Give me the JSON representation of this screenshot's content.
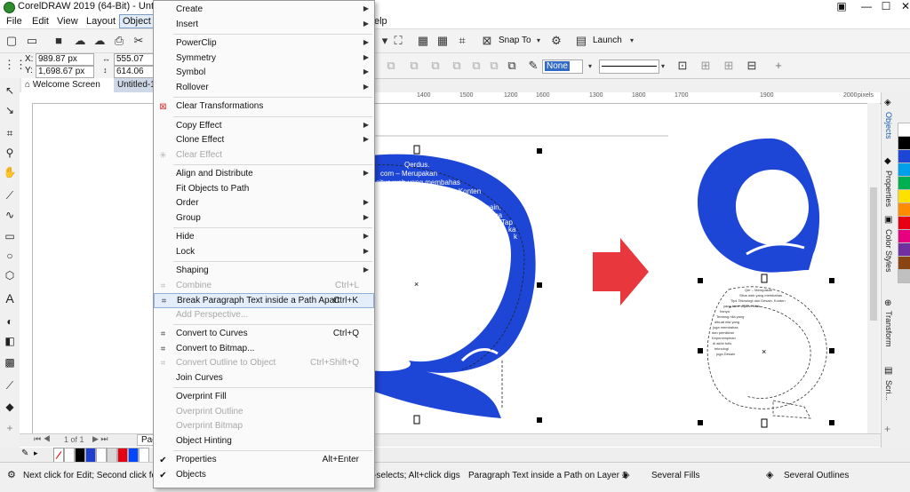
{
  "window": {
    "title": "CorelDRAW 2019 (64-Bit) - Untitled-1*"
  },
  "menubar": {
    "items": [
      "File",
      "Edit",
      "View",
      "Layout",
      "Object"
    ],
    "help": "elp"
  },
  "toolbar": {
    "snap_label": "Snap To",
    "launch_label": "Launch"
  },
  "property_bar": {
    "x_label": "X:",
    "x_value": "989.87 px",
    "y_label": "Y:",
    "y_value": "1,698.67 px",
    "w_value": "555.07 px",
    "h_value": "614.06 px",
    "outline_value": "None"
  },
  "tabs": {
    "welcome": "Welcome Screen",
    "doc": "Untitled-1"
  },
  "ruler": {
    "ticks": [
      "1200",
      "1300",
      "1400",
      "1500",
      "1600",
      "1700",
      "1800",
      "1900",
      "2000"
    ],
    "unit": "pixels"
  },
  "page_nav": {
    "label": "1 of 1",
    "page_tab": "Pag"
  },
  "artwork": {
    "path_text_lines": [
      "Qerdus.",
      "com – Merupakan",
      "ah situs web yang membahas",
      "Tips Teknologi dan Desain. Konten",
      "sajikan tidak",
      "hanya",
      "desain,",
      "juga",
      "Tap",
      "ka",
      "k"
    ],
    "small_text_lines": [
      "Qer – Merupakan",
      "Situs web yang membahas",
      "Tips Teknologi dan Desain. Konten",
      "yang kami sajikan tidak",
      "hanya",
      "Tentang nila yang",
      "dibuat nila yang",
      "juga membahas",
      "dan pemikiran",
      "Kepemimpinan",
      "di akhir tulis",
      "teknologi",
      "juga Desain"
    ],
    "blue": "#1d45d6",
    "arrow": "#e8383d"
  },
  "docker_tabs": [
    "Objects",
    "Properties",
    "Color Styles",
    "Transform",
    "Scri..."
  ],
  "context_menu": {
    "items": [
      {
        "label": "Create",
        "arrow": true
      },
      {
        "label": "Insert",
        "arrow": true
      },
      {
        "sep": true
      },
      {
        "label": "PowerClip",
        "arrow": true
      },
      {
        "label": "Symmetry",
        "arrow": true
      },
      {
        "label": "Symbol",
        "arrow": true
      },
      {
        "label": "Rollover",
        "arrow": true
      },
      {
        "sep": true
      },
      {
        "label": "Clear Transformations",
        "icon": "clear-transform-icon"
      },
      {
        "sep": true
      },
      {
        "label": "Copy Effect",
        "arrow": true
      },
      {
        "label": "Clone Effect",
        "arrow": true
      },
      {
        "label": "Clear Effect",
        "disabled": true,
        "icon": "clear-effect-icon"
      },
      {
        "sep": true
      },
      {
        "label": "Align and Distribute",
        "arrow": true
      },
      {
        "label": "Fit Objects to Path"
      },
      {
        "label": "Order",
        "arrow": true
      },
      {
        "label": "Group",
        "arrow": true
      },
      {
        "sep": true
      },
      {
        "label": "Hide",
        "arrow": true
      },
      {
        "label": "Lock",
        "arrow": true
      },
      {
        "sep": true
      },
      {
        "label": "Shaping",
        "arrow": true
      },
      {
        "label": "Combine",
        "shortcut": "Ctrl+L",
        "disabled": true,
        "icon": "combine-icon"
      },
      {
        "label": "Break Paragraph Text inside a Path Apart",
        "shortcut": "Ctrl+K",
        "highlight": true,
        "icon": "break-apart-icon"
      },
      {
        "label": "Add Perspective...",
        "disabled": true
      },
      {
        "sep": true
      },
      {
        "label": "Convert to Curves",
        "shortcut": "Ctrl+Q",
        "icon": "convert-curves-icon"
      },
      {
        "label": "Convert to Bitmap...",
        "icon": "convert-bitmap-icon"
      },
      {
        "label": "Convert Outline to Object",
        "shortcut": "Ctrl+Shift+Q",
        "disabled": true,
        "icon": "outline-object-icon"
      },
      {
        "label": "Join Curves"
      },
      {
        "sep": true
      },
      {
        "label": "Overprint Fill"
      },
      {
        "label": "Overprint Outline",
        "disabled": true
      },
      {
        "label": "Overprint Bitmap",
        "disabled": true
      },
      {
        "label": "Object Hinting"
      },
      {
        "sep": true
      },
      {
        "label": "Properties",
        "shortcut": "Alt+Enter",
        "check": true
      },
      {
        "label": "Objects",
        "check": true
      }
    ]
  },
  "statusbar": {
    "hint": "Next click for Edit; Second click for D",
    "hint2": "l-selects; Alt+click digs",
    "object": "Paragraph Text inside a Path on Layer 1",
    "fills": "Several Fills",
    "outlines": "Several Outlines"
  },
  "palette": [
    "#ffffff",
    "#000000",
    "#1e3fcf",
    "#ffffff",
    "#d8d8d8",
    "#e60012",
    "#0047ff",
    "#ffffff"
  ],
  "right_palette": [
    "#ffffff",
    "#000000",
    "#1d45d6",
    "#00a0e9",
    "#00b050",
    "#ffe100",
    "#ff8c00",
    "#e60012",
    "#e4007f",
    "#7030a0",
    "#8b4513",
    "#c0c0c0"
  ]
}
